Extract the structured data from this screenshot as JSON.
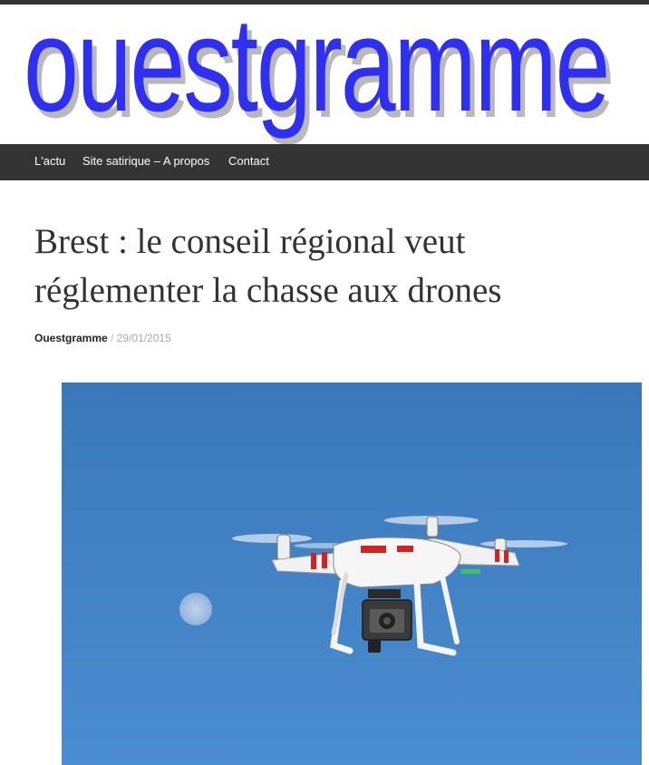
{
  "site": {
    "logo_text": "ouestgramme"
  },
  "nav": {
    "items": [
      {
        "label": "L'actu"
      },
      {
        "label": "Site satirique – A propos"
      },
      {
        "label": "Contact"
      }
    ]
  },
  "post": {
    "title": "Brest : le conseil régional veut réglementer la chasse aux drones",
    "author": "Ouestgramme",
    "separator": " / ",
    "date": "29/01/2015"
  },
  "colors": {
    "logo": "#2f2ff2",
    "navbar": "#343434",
    "sky": "#3b7fc0"
  },
  "image": {
    "subject": "quadcopter drone flying in blue sky with moon"
  }
}
